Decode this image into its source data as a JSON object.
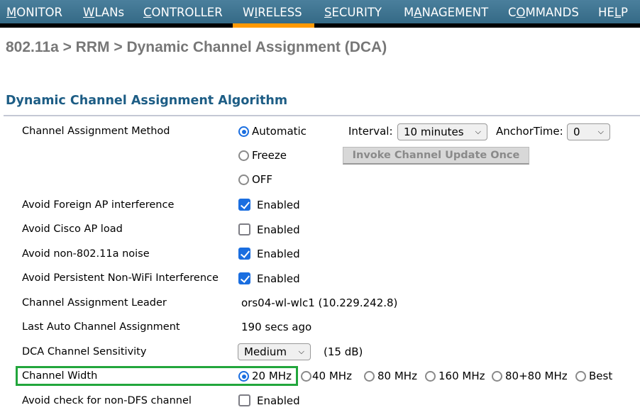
{
  "nav": {
    "items": [
      {
        "pre": "",
        "u": "M",
        "post": "ONITOR"
      },
      {
        "pre": "",
        "u": "W",
        "post": "LANs"
      },
      {
        "pre": "",
        "u": "C",
        "post": "ONTROLLER"
      },
      {
        "pre": "W",
        "u": "I",
        "post": "RELESS"
      },
      {
        "pre": "",
        "u": "S",
        "post": "ECURITY"
      },
      {
        "pre": "M",
        "u": "A",
        "post": "NAGEMENT"
      },
      {
        "pre": "C",
        "u": "O",
        "post": "MMANDS"
      },
      {
        "pre": "HE",
        "u": "L",
        "post": "P"
      }
    ],
    "active": "WIRELESS",
    "colors": {
      "active_bar": "#ff9900",
      "bar": "#3f7591"
    }
  },
  "breadcrumb": "802.11a > RRM > Dynamic Channel Assignment (DCA)",
  "section_title": "Dynamic Channel Assignment Algorithm",
  "method": {
    "label": "Channel Assignment Method",
    "options": [
      "Automatic",
      "Freeze",
      "OFF"
    ],
    "selected": "Automatic",
    "interval_label": "Interval:",
    "interval_value": "10 minutes",
    "anchor_label": "AnchorTime:",
    "anchor_value": "0",
    "invoke_button": "Invoke Channel Update Once"
  },
  "checks": [
    {
      "label": "Avoid Foreign AP interference",
      "text": "Enabled",
      "checked": true
    },
    {
      "label": "Avoid Cisco AP load",
      "text": "Enabled",
      "checked": false
    },
    {
      "label": "Avoid non-802.11a noise",
      "text": "Enabled",
      "checked": true
    },
    {
      "label": "Avoid Persistent Non-WiFi Interference",
      "text": "Enabled",
      "checked": true
    }
  ],
  "leader": {
    "label": "Channel Assignment Leader",
    "value": "ors04-wl-wlc1 (10.229.242.8)"
  },
  "last_auto": {
    "label": "Last Auto Channel Assignment",
    "value": "190 secs ago"
  },
  "sensitivity": {
    "label": "DCA Channel Sensitivity",
    "value": "Medium",
    "note": "(15 dB)"
  },
  "width": {
    "label": "Channel Width",
    "options": [
      "20 MHz",
      " 40 MHz",
      "80 MHz",
      "160 MHz",
      "80+80 MHz",
      "Best"
    ],
    "selected": "20 MHz",
    "highlight_color": "#22a63c"
  },
  "non_dfs": {
    "label": "Avoid check for non-DFS channel",
    "text": "Enabled",
    "checked": false
  }
}
